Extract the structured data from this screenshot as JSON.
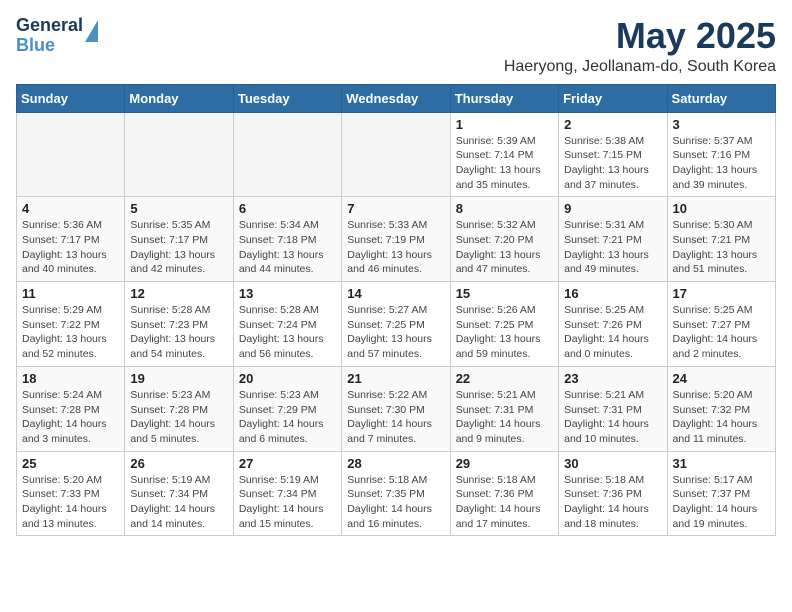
{
  "header": {
    "logo_line1": "General",
    "logo_line2": "Blue",
    "title": "May 2025",
    "location": "Haeryong, Jeollanam-do, South Korea"
  },
  "weekdays": [
    "Sunday",
    "Monday",
    "Tuesday",
    "Wednesday",
    "Thursday",
    "Friday",
    "Saturday"
  ],
  "weeks": [
    [
      {
        "day": "",
        "info": ""
      },
      {
        "day": "",
        "info": ""
      },
      {
        "day": "",
        "info": ""
      },
      {
        "day": "",
        "info": ""
      },
      {
        "day": "1",
        "info": "Sunrise: 5:39 AM\nSunset: 7:14 PM\nDaylight: 13 hours\nand 35 minutes."
      },
      {
        "day": "2",
        "info": "Sunrise: 5:38 AM\nSunset: 7:15 PM\nDaylight: 13 hours\nand 37 minutes."
      },
      {
        "day": "3",
        "info": "Sunrise: 5:37 AM\nSunset: 7:16 PM\nDaylight: 13 hours\nand 39 minutes."
      }
    ],
    [
      {
        "day": "4",
        "info": "Sunrise: 5:36 AM\nSunset: 7:17 PM\nDaylight: 13 hours\nand 40 minutes."
      },
      {
        "day": "5",
        "info": "Sunrise: 5:35 AM\nSunset: 7:17 PM\nDaylight: 13 hours\nand 42 minutes."
      },
      {
        "day": "6",
        "info": "Sunrise: 5:34 AM\nSunset: 7:18 PM\nDaylight: 13 hours\nand 44 minutes."
      },
      {
        "day": "7",
        "info": "Sunrise: 5:33 AM\nSunset: 7:19 PM\nDaylight: 13 hours\nand 46 minutes."
      },
      {
        "day": "8",
        "info": "Sunrise: 5:32 AM\nSunset: 7:20 PM\nDaylight: 13 hours\nand 47 minutes."
      },
      {
        "day": "9",
        "info": "Sunrise: 5:31 AM\nSunset: 7:21 PM\nDaylight: 13 hours\nand 49 minutes."
      },
      {
        "day": "10",
        "info": "Sunrise: 5:30 AM\nSunset: 7:21 PM\nDaylight: 13 hours\nand 51 minutes."
      }
    ],
    [
      {
        "day": "11",
        "info": "Sunrise: 5:29 AM\nSunset: 7:22 PM\nDaylight: 13 hours\nand 52 minutes."
      },
      {
        "day": "12",
        "info": "Sunrise: 5:28 AM\nSunset: 7:23 PM\nDaylight: 13 hours\nand 54 minutes."
      },
      {
        "day": "13",
        "info": "Sunrise: 5:28 AM\nSunset: 7:24 PM\nDaylight: 13 hours\nand 56 minutes."
      },
      {
        "day": "14",
        "info": "Sunrise: 5:27 AM\nSunset: 7:25 PM\nDaylight: 13 hours\nand 57 minutes."
      },
      {
        "day": "15",
        "info": "Sunrise: 5:26 AM\nSunset: 7:25 PM\nDaylight: 13 hours\nand 59 minutes."
      },
      {
        "day": "16",
        "info": "Sunrise: 5:25 AM\nSunset: 7:26 PM\nDaylight: 14 hours\nand 0 minutes."
      },
      {
        "day": "17",
        "info": "Sunrise: 5:25 AM\nSunset: 7:27 PM\nDaylight: 14 hours\nand 2 minutes."
      }
    ],
    [
      {
        "day": "18",
        "info": "Sunrise: 5:24 AM\nSunset: 7:28 PM\nDaylight: 14 hours\nand 3 minutes."
      },
      {
        "day": "19",
        "info": "Sunrise: 5:23 AM\nSunset: 7:28 PM\nDaylight: 14 hours\nand 5 minutes."
      },
      {
        "day": "20",
        "info": "Sunrise: 5:23 AM\nSunset: 7:29 PM\nDaylight: 14 hours\nand 6 minutes."
      },
      {
        "day": "21",
        "info": "Sunrise: 5:22 AM\nSunset: 7:30 PM\nDaylight: 14 hours\nand 7 minutes."
      },
      {
        "day": "22",
        "info": "Sunrise: 5:21 AM\nSunset: 7:31 PM\nDaylight: 14 hours\nand 9 minutes."
      },
      {
        "day": "23",
        "info": "Sunrise: 5:21 AM\nSunset: 7:31 PM\nDaylight: 14 hours\nand 10 minutes."
      },
      {
        "day": "24",
        "info": "Sunrise: 5:20 AM\nSunset: 7:32 PM\nDaylight: 14 hours\nand 11 minutes."
      }
    ],
    [
      {
        "day": "25",
        "info": "Sunrise: 5:20 AM\nSunset: 7:33 PM\nDaylight: 14 hours\nand 13 minutes."
      },
      {
        "day": "26",
        "info": "Sunrise: 5:19 AM\nSunset: 7:34 PM\nDaylight: 14 hours\nand 14 minutes."
      },
      {
        "day": "27",
        "info": "Sunrise: 5:19 AM\nSunset: 7:34 PM\nDaylight: 14 hours\nand 15 minutes."
      },
      {
        "day": "28",
        "info": "Sunrise: 5:18 AM\nSunset: 7:35 PM\nDaylight: 14 hours\nand 16 minutes."
      },
      {
        "day": "29",
        "info": "Sunrise: 5:18 AM\nSunset: 7:36 PM\nDaylight: 14 hours\nand 17 minutes."
      },
      {
        "day": "30",
        "info": "Sunrise: 5:18 AM\nSunset: 7:36 PM\nDaylight: 14 hours\nand 18 minutes."
      },
      {
        "day": "31",
        "info": "Sunrise: 5:17 AM\nSunset: 7:37 PM\nDaylight: 14 hours\nand 19 minutes."
      }
    ]
  ]
}
